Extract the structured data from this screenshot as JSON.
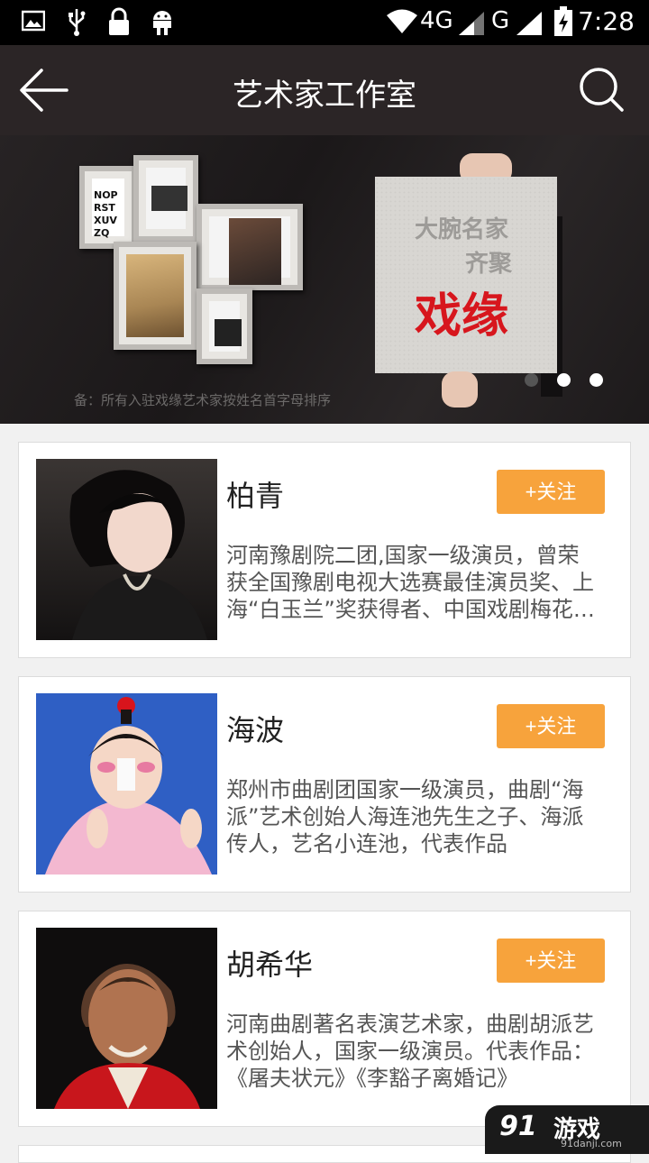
{
  "status_bar": {
    "time": "7:28",
    "network_4g": "4G",
    "network_g": "G",
    "icons": [
      "image-icon",
      "usb-icon",
      "lock-icon",
      "android-icon",
      "wifi-icon",
      "signal-icon",
      "battery-charging-icon"
    ]
  },
  "header": {
    "title": "艺术家工作室",
    "back_icon": "back-arrow-icon",
    "search_icon": "search-icon"
  },
  "banner": {
    "board_line1": "大腕名家",
    "board_line2": "齐聚",
    "board_big": "戏缘",
    "note": "备：所有入驻戏缘艺术家按姓名首字母排序",
    "active_slide": 1,
    "slide_count": 3
  },
  "artists": [
    {
      "name": "柏青",
      "follow_label": "+关注",
      "description": "河南豫剧院二团,国家一级演员，曾荣获全国豫剧电视大选赛最佳演员奖、上海“白玉兰”奖获得者、中国戏剧梅花奖获得者"
    },
    {
      "name": "海波",
      "follow_label": "+关注",
      "description": "郑州市曲剧团国家一级演员，曲剧“海派”艺术创始人海连池先生之子、海派传人，艺名小连池，代表作品"
    },
    {
      "name": "胡希华",
      "follow_label": "+关注",
      "description": "河南曲剧著名表演艺术家，曲剧胡派艺术创始人，国家一级演员。代表作品：《屠夫状元》《李豁子离婚记》"
    }
  ],
  "watermark": {
    "logo": "91",
    "text": "游戏",
    "sub": "91danji.com"
  },
  "colors": {
    "accent": "#f7a33c",
    "title_bar": "#2b2526",
    "banner_red": "#d7161d"
  }
}
